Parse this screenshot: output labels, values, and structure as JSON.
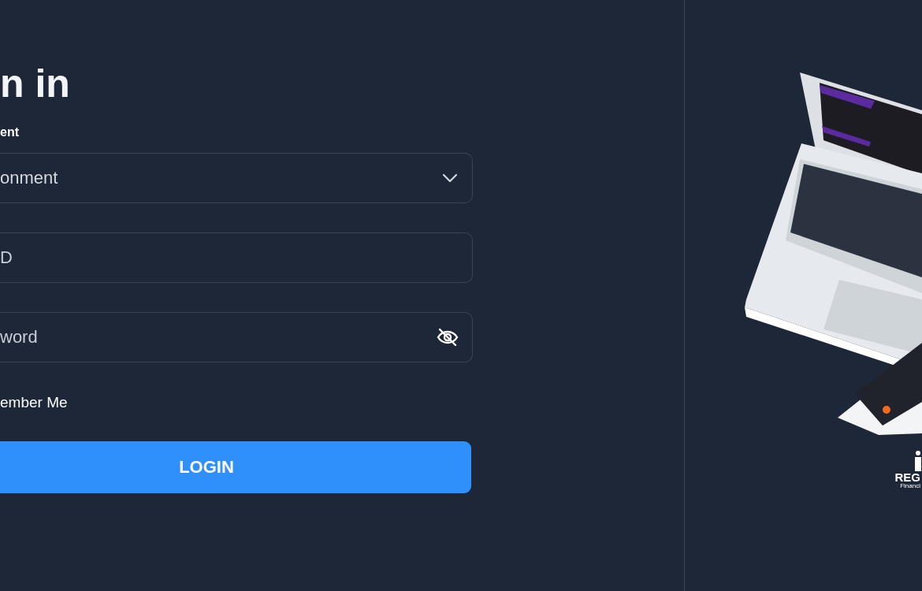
{
  "heading": "n in",
  "environment": {
    "label": "ent",
    "value": "onment"
  },
  "user_id": {
    "placeholder": "D"
  },
  "password": {
    "placeholder": "word"
  },
  "remember": {
    "label": "ember Me"
  },
  "login_button": "LOGIN",
  "brand": {
    "name": "REG",
    "tagline": "Financi"
  }
}
